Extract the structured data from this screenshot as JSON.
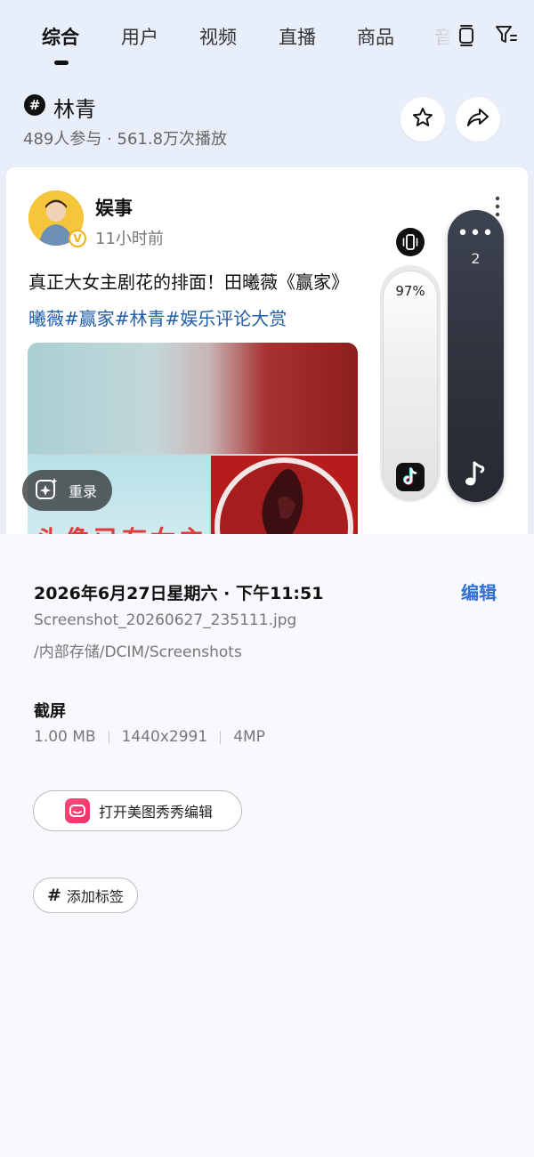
{
  "tabs": [
    {
      "label": "综合",
      "active": true
    },
    {
      "label": "用户",
      "active": false
    },
    {
      "label": "视频",
      "active": false
    },
    {
      "label": "直播",
      "active": false
    },
    {
      "label": "商品",
      "active": false
    },
    {
      "label": "音",
      "active": false
    }
  ],
  "topic": {
    "hash": "#",
    "title": "林青",
    "stats": "489人参与 · 561.8万次播放"
  },
  "post": {
    "author": "娱事",
    "verified_mark": "V",
    "time": "11小时前",
    "line1": "真正大女主剧花的排面！田曦薇《赢家》",
    "line1_tail": "剧",
    "line2": "曦薇#赢家#林青#娱乐评论大赏",
    "media_overlay_text": "头像已有女主",
    "replay_label": "重录"
  },
  "side_controls": {
    "volume_percent_label": "97%",
    "volume_level": 0.97,
    "dots": "•••",
    "count": "2"
  },
  "details": {
    "date": "2026年6月27日星期六 · 下午11:51",
    "edit": "编辑",
    "filename": "Screenshot_20260627_235111.jpg",
    "path": "/内部存储/DCIM/Screenshots",
    "type": "截屏",
    "size": "1.00 MB",
    "resolution": "1440x2991",
    "megapixels": "4MP",
    "open_meitu": "打开美图秀秀编辑",
    "add_tag": "添加标签",
    "tag_hash": "#"
  },
  "colors": {
    "top_bg": "#e8effb",
    "panel_bg": "#f8f9fd",
    "link_blue": "#1f5ea8",
    "edit_blue": "#2f6fd6",
    "badge_gold": "#f2b21b"
  },
  "icons": [
    "tablet-icon",
    "filter-icon",
    "star-icon",
    "share-icon",
    "more-vertical-icon",
    "sparkle-capture-icon",
    "vibrate-icon",
    "tiktok-icon",
    "music-note-icon",
    "meitu-icon",
    "hash-icon"
  ]
}
